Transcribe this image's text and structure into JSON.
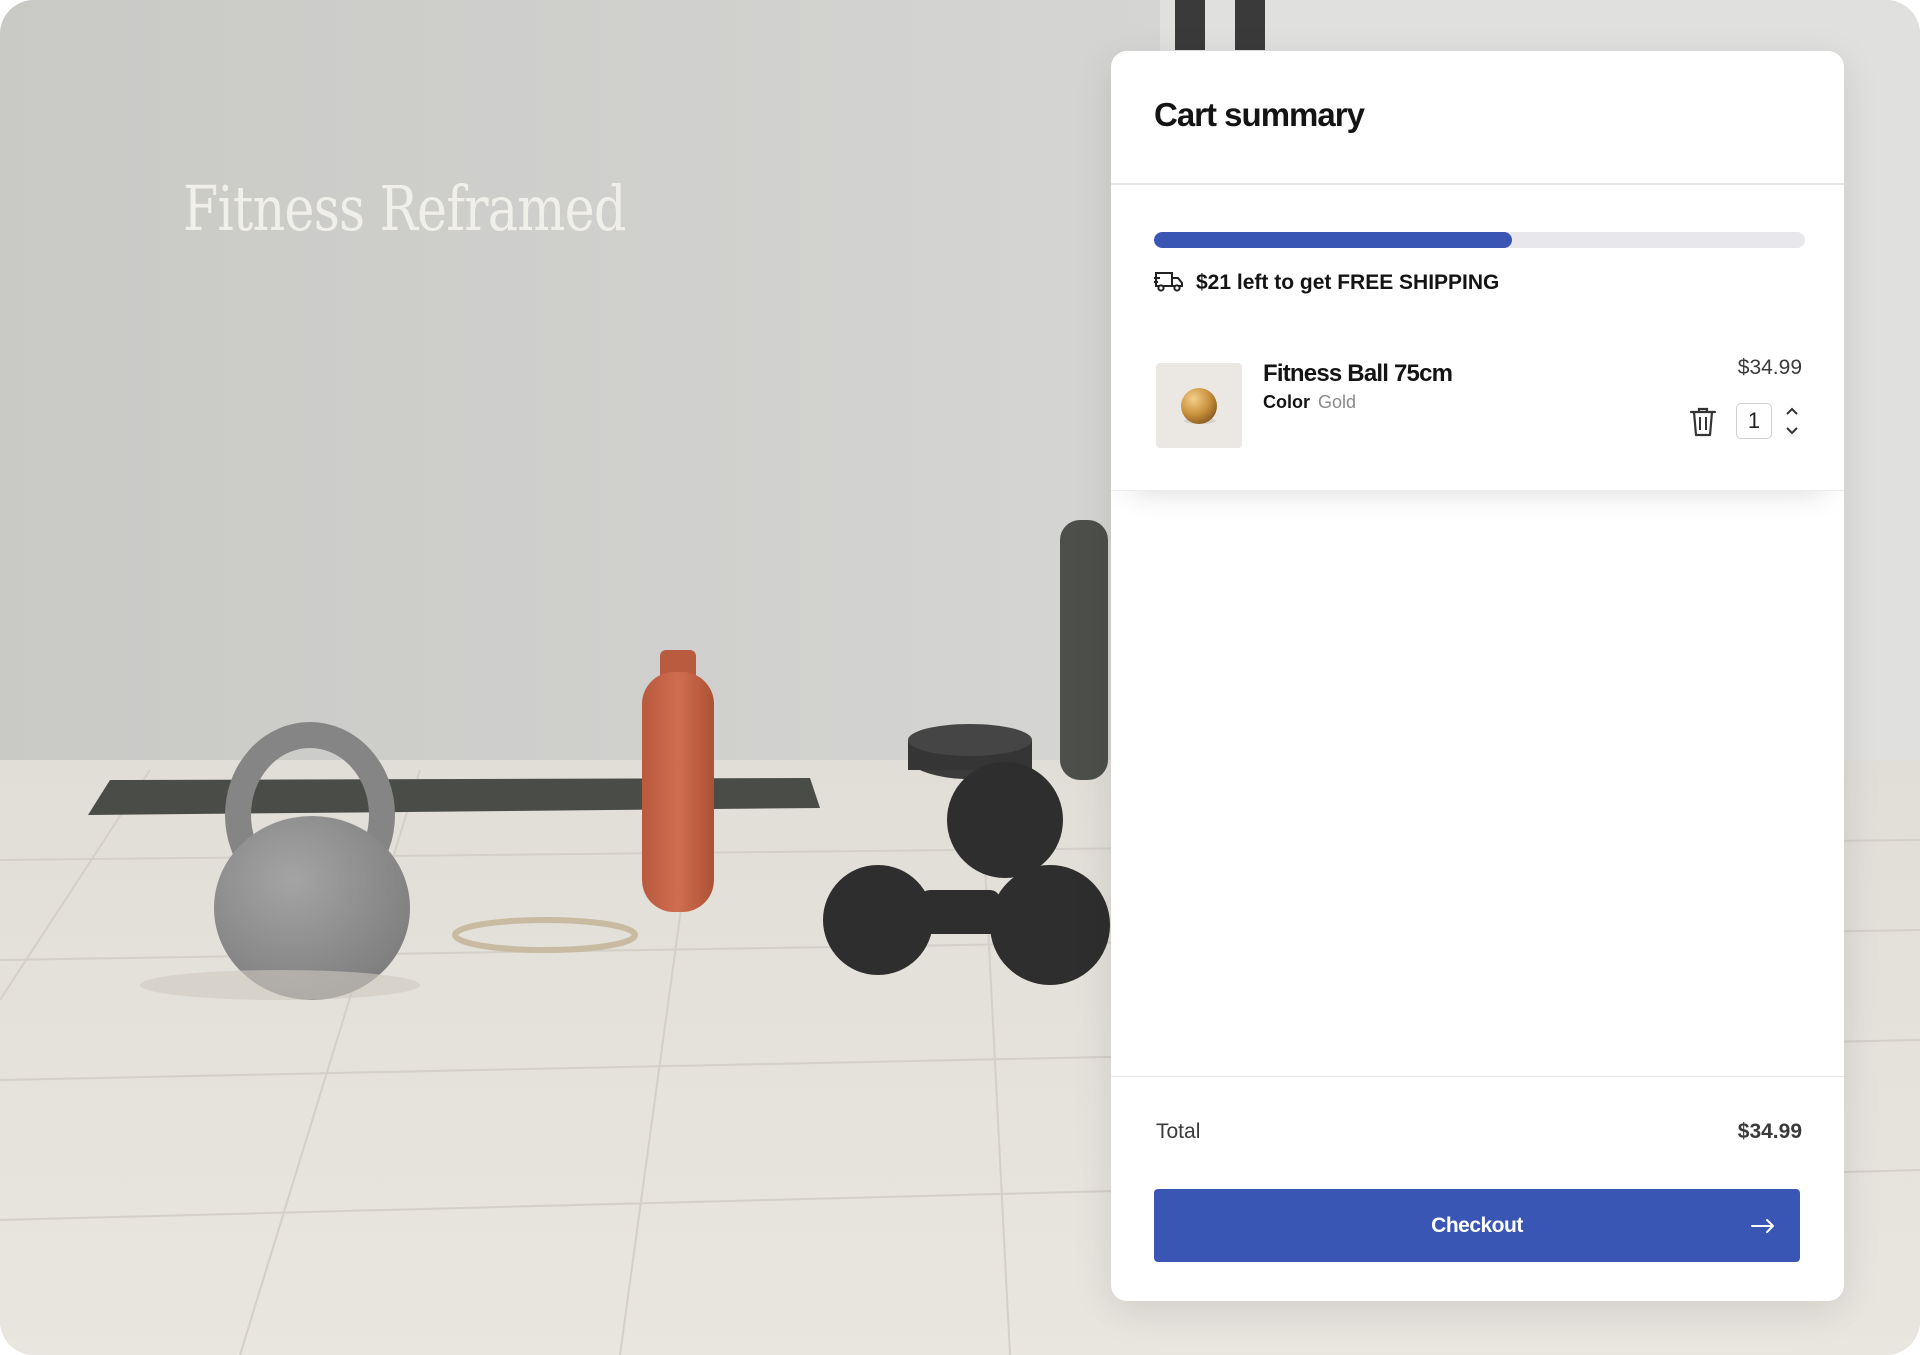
{
  "hero": {
    "title": "Fitness Reframed"
  },
  "cart": {
    "title": "Cart summary",
    "shipping_progress": 0.55,
    "shipping_message": "$21 left to get FREE SHIPPING",
    "shipping_icon": "delivery-truck-icon",
    "items": [
      {
        "name": "Fitness Ball 75cm",
        "variant_label": "Color",
        "variant_value": "Gold",
        "price": "$34.99",
        "quantity": "1"
      }
    ],
    "total_label": "Total",
    "total_value": "$34.99",
    "checkout_label": "Checkout"
  },
  "colors": {
    "accent": "#3a56b5",
    "track": "#e8e8ec",
    "text": "#141414",
    "muted": "#8a8a8a"
  }
}
